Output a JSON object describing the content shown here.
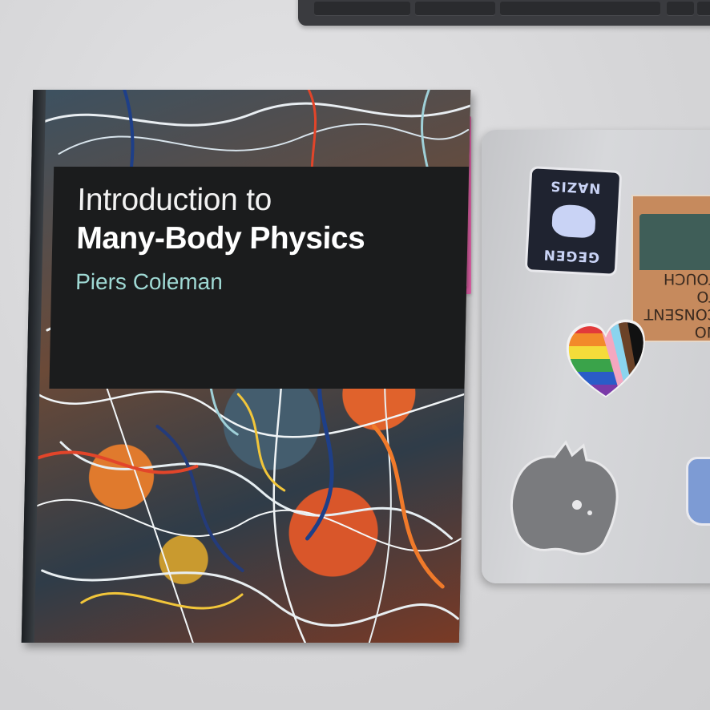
{
  "book": {
    "title_line1": "Introduction to",
    "title_line2": "Many-Body Physics",
    "author": "Piers Coleman"
  },
  "stickers": {
    "nazis_top": "NAZIS",
    "nazis_bottom": "GEGEN",
    "consent_text": "NO CONSENT TO TOUCH"
  },
  "colors": {
    "title_band": "#1b1c1d",
    "author_text": "#9fd9d4",
    "sticky_note": "#f46ab6",
    "laptop": "#d0d1d4"
  }
}
